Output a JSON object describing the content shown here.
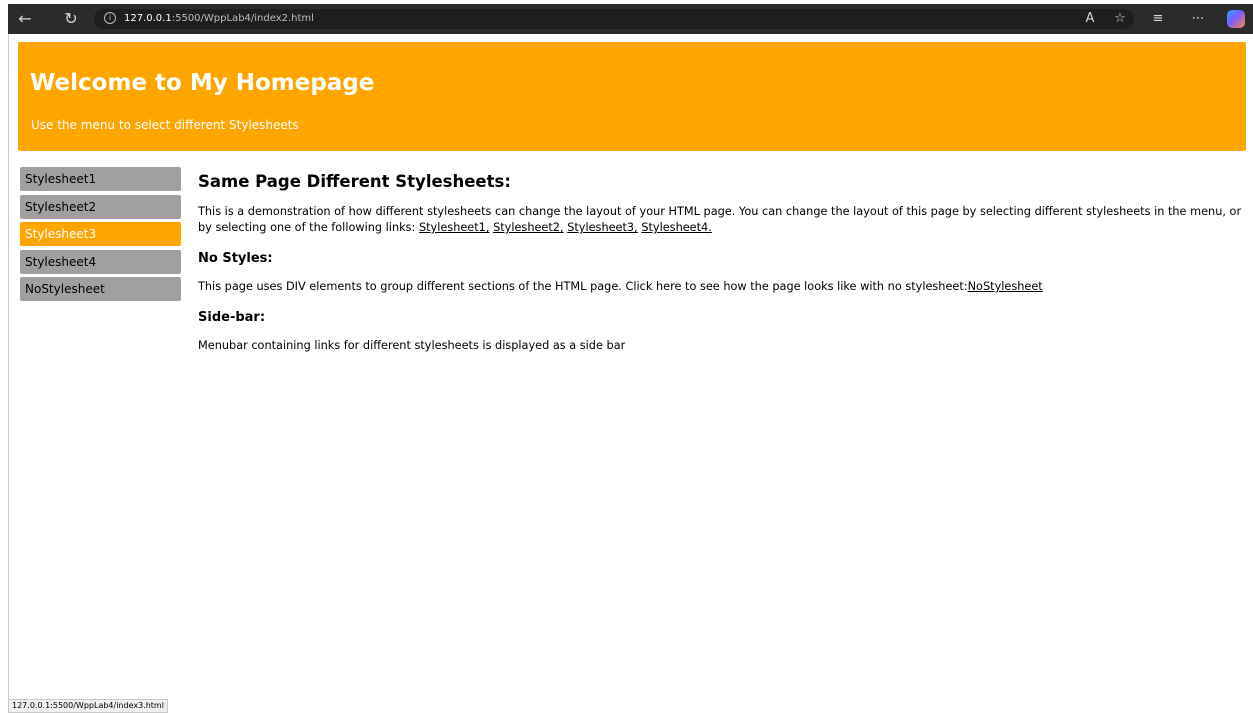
{
  "browser": {
    "address_host": "127.0.0.1",
    "address_path": ":5500/WppLab4/index2.html",
    "status_url": "127.0.0.1:5500/WppLab4/index3.html"
  },
  "header": {
    "title": "Welcome to My Homepage",
    "subtitle": "Use the menu to select different Stylesheets"
  },
  "menu": {
    "items": [
      {
        "label": "Stylesheet1",
        "active": false
      },
      {
        "label": "Stylesheet2",
        "active": false
      },
      {
        "label": "Stylesheet3",
        "active": true
      },
      {
        "label": "Stylesheet4",
        "active": false
      },
      {
        "label": "NoStylesheet",
        "active": false
      }
    ]
  },
  "content": {
    "heading": "Same Page Different Stylesheets:",
    "intro": "This is a demonstration of how different stylesheets can change the layout of your HTML page. You can change the layout of this page by selecting different stylesheets in the menu, or by selecting one of the following links: ",
    "links": [
      "Stylesheet1,",
      "Stylesheet2,",
      "Stylesheet3,",
      "Stylesheet4."
    ],
    "no_styles_heading": "No Styles:",
    "no_styles_text": "This page uses DIV elements to group different sections of the HTML page. Click here to see how the page looks like with no stylesheet:",
    "no_styles_link": "NoStylesheet",
    "sidebar_heading": "Side-bar:",
    "sidebar_text": "Menubar containing links for different stylesheets is displayed as a side bar"
  },
  "colors": {
    "accent": "#ffa500",
    "menu_inactive": "#a0a0a0"
  }
}
